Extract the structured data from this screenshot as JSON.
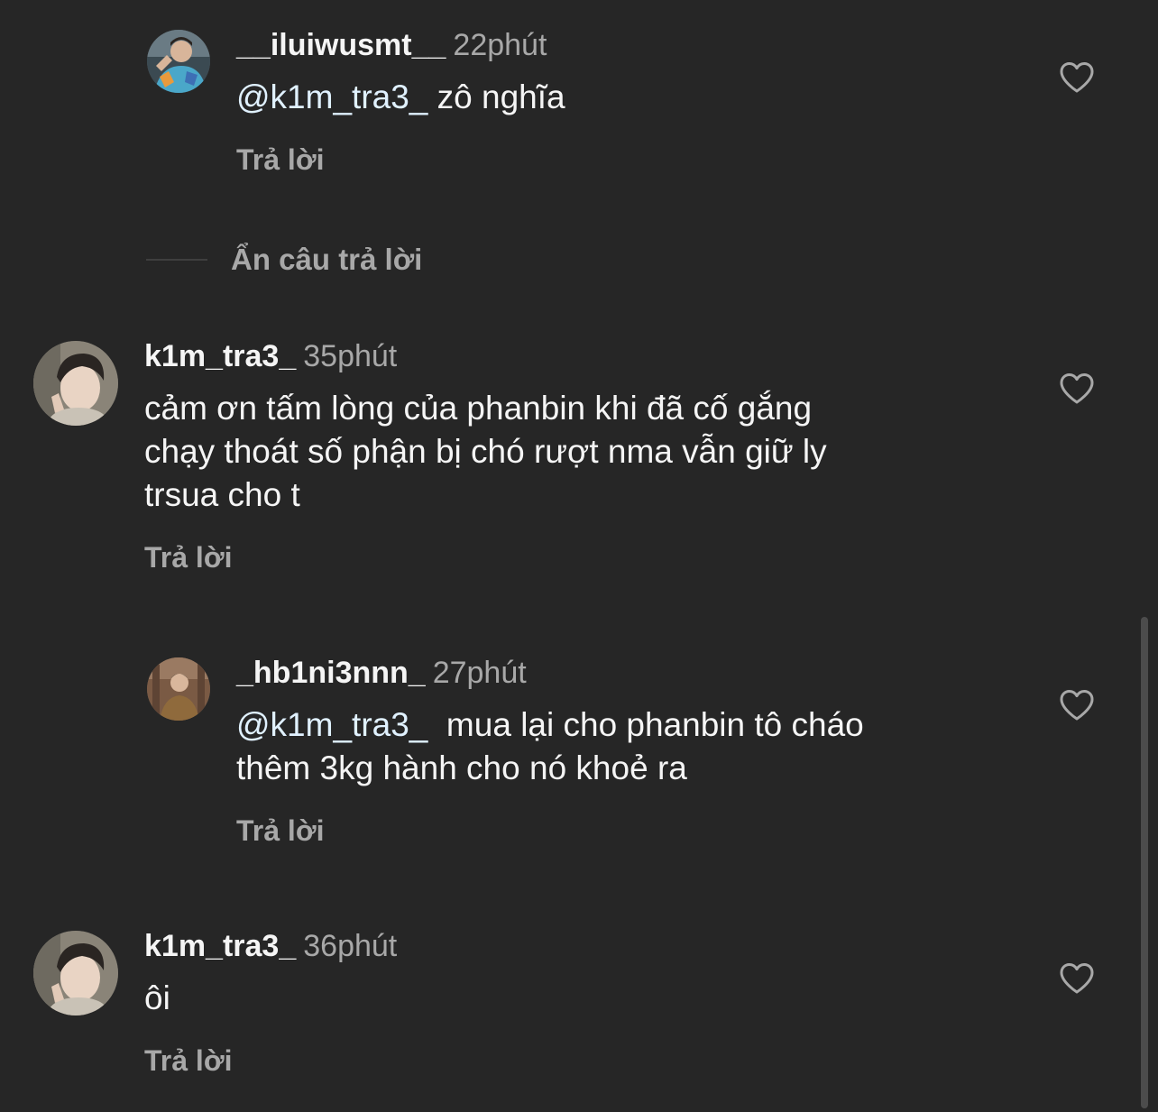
{
  "comments": [
    {
      "username": "__iluiwusmt__",
      "time": "22phút",
      "mention": "@k1m_tra3_",
      "text": " zô nghĩa",
      "reply_label": "Trả lời",
      "icon": "heart-outline-icon"
    },
    {
      "username": "k1m_tra3_",
      "time": "35phút",
      "text_lines": [
        "cảm ơn tấm lòng của phanbin khi đã cố gắng",
        "chạy thoát số phận bị chó rượt nma vẫn giữ ly",
        "trsua cho t"
      ],
      "reply_label": "Trả lời",
      "icon": "heart-outline-icon"
    },
    {
      "username": "_hb1ni3nnn_",
      "time": "27phút",
      "mention": "@k1m_tra3_",
      "text_lines": [
        "  mua lại cho phanbin tô cháo",
        "thêm 3kg hành cho nó khoẻ ra"
      ],
      "reply_label": "Trả lời",
      "icon": "heart-outline-icon"
    },
    {
      "username": "k1m_tra3_",
      "time": "36phút",
      "text": "ôi",
      "reply_label": "Trả lời",
      "icon": "heart-outline-icon"
    }
  ],
  "hide_replies_label": "Ẩn câu trả lời",
  "colors": {
    "background": "#262626",
    "primary_text": "#f5f5f5",
    "secondary_text": "#a8a8a8",
    "mention": "#e0f1ff"
  }
}
